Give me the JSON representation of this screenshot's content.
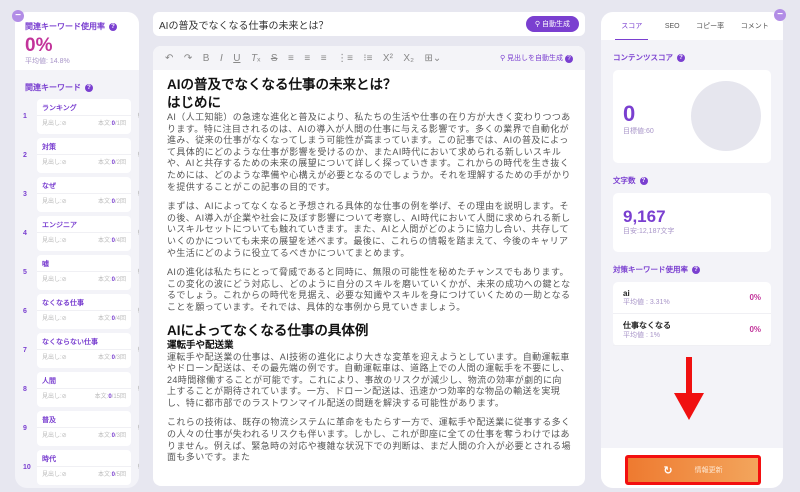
{
  "left": {
    "title": "関連キーワード使用率",
    "rate": "0%",
    "average": "平均値: 14.8%",
    "kw_title": "関連キーワード",
    "heading_label": "見出し:",
    "body_label": "本文:",
    "keywords": [
      {
        "n": "1",
        "name": "ランキング",
        "count": "0",
        "target": "/1回"
      },
      {
        "n": "2",
        "name": "対策",
        "count": "0",
        "target": "/2回"
      },
      {
        "n": "3",
        "name": "なぜ",
        "count": "0",
        "target": "/2回"
      },
      {
        "n": "4",
        "name": "エンジニア",
        "count": "0",
        "target": "/4回"
      },
      {
        "n": "5",
        "name": "嘘",
        "count": "0",
        "target": "/2回"
      },
      {
        "n": "6",
        "name": "なくなる仕事",
        "count": "0",
        "target": "/4回"
      },
      {
        "n": "7",
        "name": "なくならない仕事",
        "count": "0",
        "target": "/3回"
      },
      {
        "n": "8",
        "name": "人間",
        "count": "0",
        "target": "/15回"
      },
      {
        "n": "9",
        "name": "普及",
        "count": "0",
        "target": "/3回"
      },
      {
        "n": "10",
        "name": "時代",
        "count": "0",
        "target": "/5回"
      }
    ]
  },
  "title": {
    "value": "AIの普及でなくなる仕事の未来とは？",
    "auto": "自動生成"
  },
  "toolbar": {
    "heading_auto": "見出しを自動生成"
  },
  "doc": {
    "h1": "AIの普及でなくなる仕事の未来とは？",
    "h2": "はじめに",
    "p1": "AI（人工知能）の急速な進化と普及により、私たちの生活や仕事の在り方が大きく変わりつつあります。特に注目されるのは、AIの導入が人間の仕事に与える影響です。多くの業界で自動化が進み、従来の仕事がなくなってしまう可能性が高まっています。この記事では、AIの普及によって具体的にどのような仕事が影響を受けるのか、またAI時代において求められる新しいスキルや、AIと共存するための未来の展望について詳しく探っていきます。これからの時代を生き抜くためには、どのような準備や心構えが必要となるのでしょうか。それを理解するための手がかりを提供することがこの記事の目的です。",
    "p2": "まずは、AIによってなくなると予想される具体的な仕事の例を挙げ、その理由を説明します。その後、AI導入が企業や社会に及ぼす影響について考察し、AI時代において人間に求められる新しいスキルセットについても触れていきます。また、AIと人間がどのように協力し合い、共存していくのかについても未来の展望を述べます。最後に、これらの情報を踏まえて、今後のキャリアや生活にどのように役立てるべきかについてまとめます。",
    "p3": "AIの進化は私たちにとって脅威であると同時に、無限の可能性を秘めたチャンスでもあります。この変化の波にどう対応し、どのように自分のスキルを磨いていくかが、未来の成功への鍵となるでしょう。これからの時代を見据え、必要な知識やスキルを身につけていくための一助となることを願っています。それでは、具体的な事例から見ていきましょう。",
    "h2b": "AIによってなくなる仕事の具体例",
    "h3": "運転手や配送業",
    "p4": "運転手や配送業の仕事は、AI技術の進化により大きな変革を迎えようとしています。自動運転車やドローン配送は、その最先端の例です。自動運転車は、道路上での人間の運転手を不要にし、24時間稼働することが可能です。これにより、事故のリスクが減少し、物流の効率が劇的に向上することが期待されています。一方、ドローン配送は、迅速かつ効率的な物品の輸送を実現し、特に都市部でのラストワンマイル配送の問題を解決する可能性があります。",
    "p5": "これらの技術は、既存の物流システムに革命をもたらす一方で、運転手や配送業に従事する多くの人々の仕事が失われるリスクも伴います。しかし、これが即座に全ての仕事を奪うわけではありません。例えば、緊急時の対応や複雑な状況下での判断は、まだ人間の介入が必要とされる場面も多いです。また"
  },
  "right": {
    "tabs": [
      "スコア",
      "SEO",
      "コピー率",
      "コメント"
    ],
    "content_score_title": "コンテンツスコア",
    "score": "0",
    "score_target": "目標値:60",
    "chars_title": "文字数",
    "chars": "9,167",
    "chars_target": "目安:12,187文字",
    "kw_title": "対策キーワード使用率",
    "keywords": [
      {
        "name": "ai",
        "avg": "平均値 : 3.31%",
        "pct": "0%"
      },
      {
        "name": "仕事なくなる",
        "avg": "平均値 : 1%",
        "pct": "0%"
      }
    ],
    "update": "情報更新"
  }
}
